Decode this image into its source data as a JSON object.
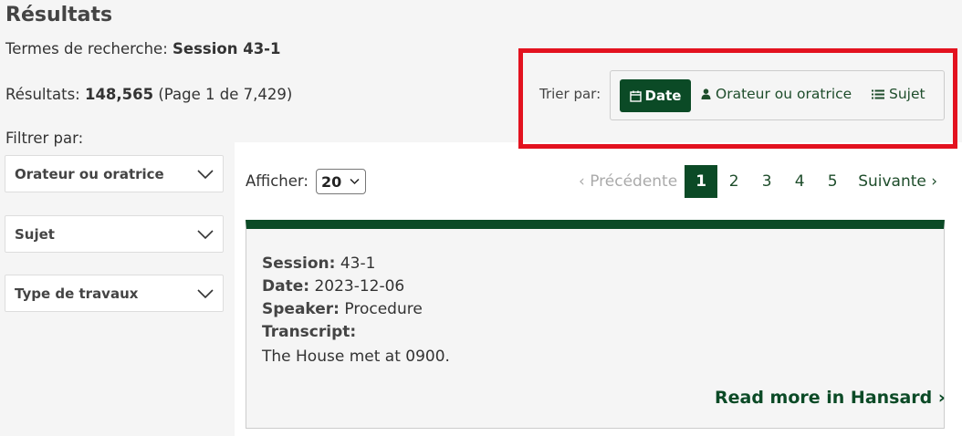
{
  "header": {
    "title": "Résultats",
    "terms_label": "Termes de recherche: ",
    "terms_value": "Session 43-1",
    "results_label": "Résultats: ",
    "results_count": "148,565",
    "results_page": " (Page 1 de 7,429)"
  },
  "filters": {
    "label": "Filtrer par:",
    "items": [
      {
        "label": "Orateur ou oratrice"
      },
      {
        "label": "Sujet"
      },
      {
        "label": "Type de travaux"
      }
    ]
  },
  "sort": {
    "label": "Trier par:",
    "options": [
      {
        "label": "Date",
        "icon": "calendar-icon",
        "active": true
      },
      {
        "label": "Orateur ou oratrice",
        "icon": "user-icon",
        "active": false
      },
      {
        "label": "Sujet",
        "icon": "list-icon",
        "active": false
      }
    ],
    "highlight_color": "#e3121f"
  },
  "toolbar": {
    "show_label": "Afficher:",
    "per_page": "20"
  },
  "pagination": {
    "prev": "‹ Précédente",
    "pages": [
      "1",
      "2",
      "3",
      "4",
      "5"
    ],
    "current": "1",
    "next": "Suivante ›"
  },
  "result": {
    "session_label": "Session:",
    "session_value": " 43-1",
    "date_label": "Date:",
    "date_value": " 2023-12-06",
    "speaker_label": "Speaker:",
    "speaker_value": " Procedure",
    "transcript_label": "Transcript:",
    "transcript_text": "The House met at 0900.",
    "read_more": "Read more in Hansard ›"
  },
  "colors": {
    "accent": "#0b4a26",
    "link": "#1e4d2b"
  }
}
